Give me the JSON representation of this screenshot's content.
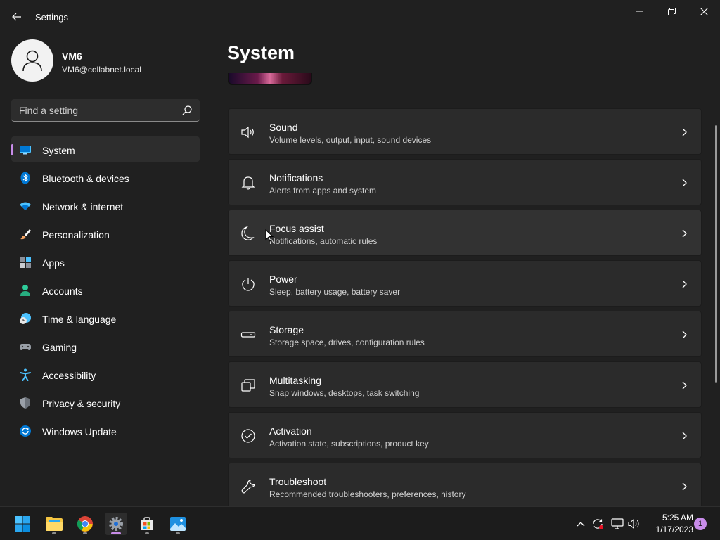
{
  "window": {
    "title": "Settings"
  },
  "profile": {
    "name": "VM6",
    "email": "VM6@collabnet.local"
  },
  "search": {
    "placeholder": "Find a setting"
  },
  "sidebar": {
    "items": [
      {
        "label": "System",
        "icon": "monitor-icon",
        "active": true
      },
      {
        "label": "Bluetooth & devices",
        "icon": "bluetooth-icon"
      },
      {
        "label": "Network & internet",
        "icon": "wifi-icon"
      },
      {
        "label": "Personalization",
        "icon": "brush-icon"
      },
      {
        "label": "Apps",
        "icon": "apps-icon"
      },
      {
        "label": "Accounts",
        "icon": "person-icon"
      },
      {
        "label": "Time & language",
        "icon": "clock-globe-icon"
      },
      {
        "label": "Gaming",
        "icon": "gamepad-icon"
      },
      {
        "label": "Accessibility",
        "icon": "accessibility-icon"
      },
      {
        "label": "Privacy & security",
        "icon": "shield-icon"
      },
      {
        "label": "Windows Update",
        "icon": "update-icon"
      }
    ]
  },
  "main": {
    "title": "System",
    "cards": [
      {
        "title": "Sound",
        "subtitle": "Volume levels, output, input, sound devices",
        "icon": "speaker-icon"
      },
      {
        "title": "Notifications",
        "subtitle": "Alerts from apps and system",
        "icon": "bell-icon"
      },
      {
        "title": "Focus assist",
        "subtitle": "Notifications, automatic rules",
        "icon": "moon-icon"
      },
      {
        "title": "Power",
        "subtitle": "Sleep, battery usage, battery saver",
        "icon": "power-icon"
      },
      {
        "title": "Storage",
        "subtitle": "Storage space, drives, configuration rules",
        "icon": "drive-icon"
      },
      {
        "title": "Multitasking",
        "subtitle": "Snap windows, desktops, task switching",
        "icon": "multitask-icon"
      },
      {
        "title": "Activation",
        "subtitle": "Activation state, subscriptions, product key",
        "icon": "check-circle-icon"
      },
      {
        "title": "Troubleshoot",
        "subtitle": "Recommended troubleshooters, preferences, history",
        "icon": "wrench-icon"
      }
    ]
  },
  "taskbar": {
    "apps": [
      "start-icon",
      "file-explorer-icon",
      "chrome-icon",
      "settings-gear-icon",
      "store-icon",
      "photos-icon"
    ],
    "time": "5:25 AM",
    "date": "1/17/2023",
    "notification_count": "1"
  },
  "colors": {
    "accent": "#c88ce9",
    "background": "#202020",
    "card": "#2b2b2b"
  }
}
